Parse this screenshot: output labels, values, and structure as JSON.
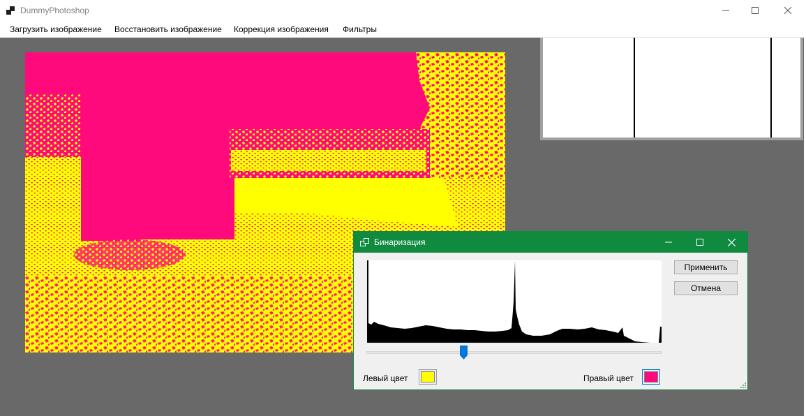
{
  "app": {
    "title": "DummyPhotoshop",
    "menu": [
      "Загрузить изображение",
      "Восстановить изображение",
      "Коррекция изображения",
      "Фильтры"
    ]
  },
  "colors": {
    "workspace": "#696969",
    "magenta": "#ff0a7c",
    "yellow": "#ffff00",
    "dialog_title": "#108a3f"
  },
  "dialog": {
    "title": "Бинаризация",
    "apply_label": "Применить",
    "cancel_label": "Отмена",
    "left_color_label": "Левый цвет",
    "right_color_label": "Правый цвет",
    "left_color": "#ffff00",
    "right_color": "#ff0a7c",
    "threshold_fraction": 0.33
  },
  "icons": {
    "minimize": "minimize-icon",
    "maximize": "maximize-icon",
    "close": "close-icon",
    "app": "app-icon"
  }
}
